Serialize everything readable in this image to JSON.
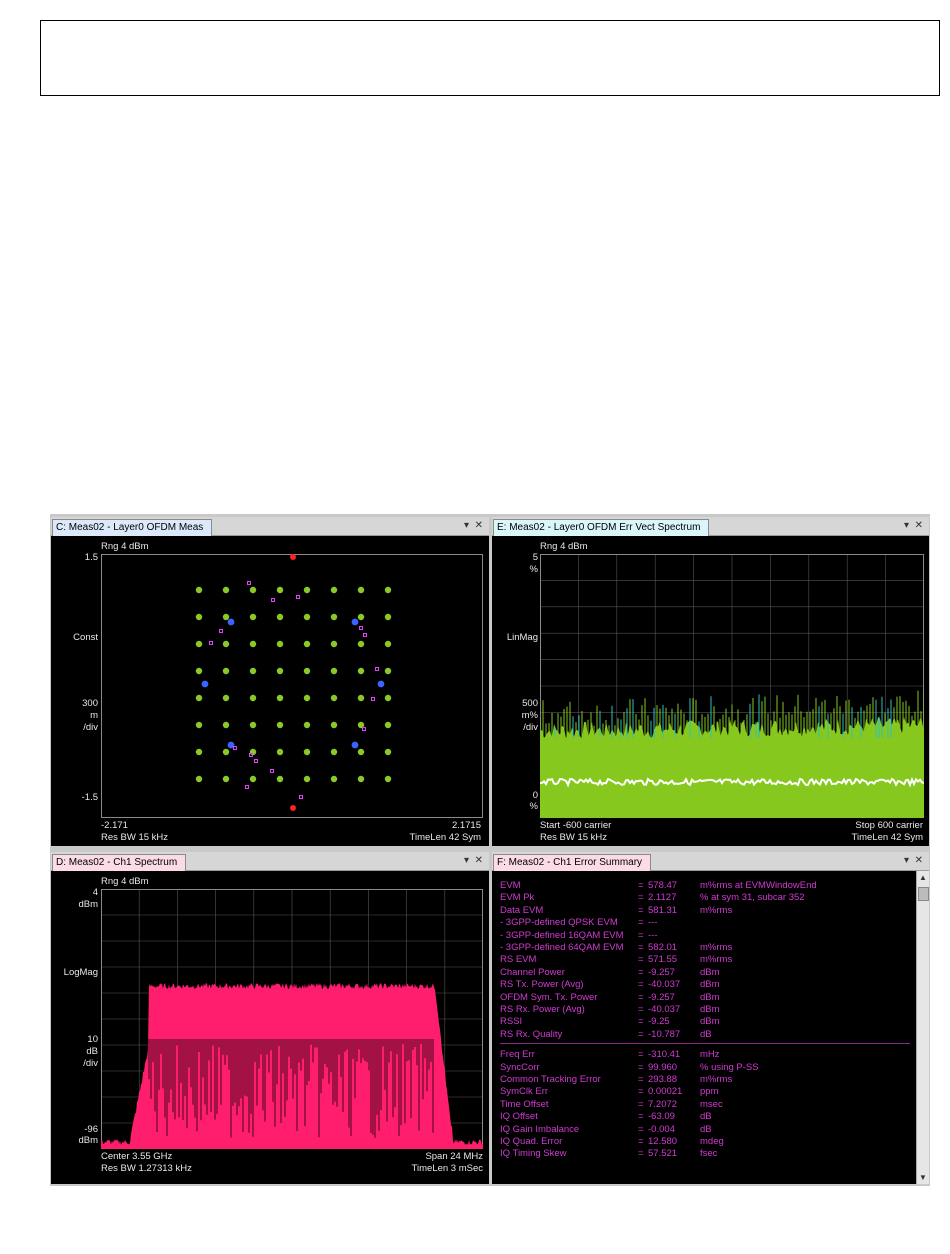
{
  "panels": {
    "c": {
      "tab": "C: Meas02 - Layer0 OFDM Meas",
      "ref": "Rng 4 dBm",
      "y_top": "1.5",
      "y_mode": "Const",
      "scale_1": "300",
      "scale_2": "m",
      "scale_3": "/div",
      "y_bottom": "-1.5",
      "x_left": "-2.171",
      "x_right": "2.1715",
      "footer_left": "Res BW 15 kHz",
      "footer_right": "TimeLen 42  Sym"
    },
    "e": {
      "tab": "E: Meas02 - Layer0 OFDM Err Vect Spectrum",
      "ref": "Rng 4 dBm",
      "y_top_1": "5",
      "y_top_2": "%",
      "y_mode": "LinMag",
      "scale_1": "500",
      "scale_2": "m%",
      "scale_3": "/div",
      "y_bottom_1": "0",
      "y_bottom_2": "%",
      "x_left": "Start -600  carrier",
      "x_right": "Stop 600  carrier",
      "footer_left": "Res BW 15 kHz",
      "footer_right": "TimeLen 42  Sym"
    },
    "d": {
      "tab": "D: Meas02 - Ch1 Spectrum",
      "ref": "Rng 4 dBm",
      "y_top_1": "4",
      "y_top_2": "dBm",
      "y_mode": "LogMag",
      "scale_1": "10",
      "scale_2": "dB",
      "scale_3": "/div",
      "y_bottom_1": "-96",
      "y_bottom_2": "dBm",
      "x_left": "Center 3.55 GHz",
      "x_right": "Span 24 MHz",
      "footer_left": "Res BW 1.27313 kHz",
      "footer_right": "TimeLen 3 mSec"
    },
    "f": {
      "tab": "F: Meas02 - Ch1 Error Summary",
      "rows": [
        {
          "name": "EVM",
          "eq": "=",
          "value": "578.47",
          "unit": "m%rms  at   EVMWindowEnd"
        },
        {
          "name": "EVM Pk",
          "eq": "=",
          "value": "2.1127",
          "unit": "%   at   sym 31,   subcar  352"
        },
        {
          "name": "Data EVM",
          "eq": "=",
          "value": "581.31",
          "unit": "m%rms"
        },
        {
          "name": " - 3GPP-defined QPSK EVM",
          "eq": "=",
          "value": "---",
          "unit": ""
        },
        {
          "name": " - 3GPP-defined 16QAM EVM",
          "eq": "=",
          "value": "---",
          "unit": ""
        },
        {
          "name": " - 3GPP-defined 64QAM EVM",
          "eq": "=",
          "value": "582.01",
          "unit": "m%rms"
        },
        {
          "name": "RS EVM",
          "eq": "=",
          "value": "571.55",
          "unit": "m%rms"
        },
        {
          "name": "Channel Power",
          "eq": "=",
          "value": "-9.257",
          "unit": "dBm"
        },
        {
          "name": "RS Tx. Power (Avg)",
          "eq": "=",
          "value": "-40.037",
          "unit": "dBm"
        },
        {
          "name": "OFDM Sym. Tx. Power",
          "eq": "=",
          "value": "-9.257",
          "unit": "dBm"
        },
        {
          "name": "RS Rx. Power (Avg)",
          "eq": "=",
          "value": "-40.037",
          "unit": "dBm"
        },
        {
          "name": "RSSI",
          "eq": "=",
          "value": "-9.25",
          "unit": "dBm"
        },
        {
          "name": "RS Rx. Quality",
          "eq": "=",
          "value": "-10.787",
          "unit": "dB"
        },
        {
          "name": "Freq Err",
          "eq": "=",
          "value": "-310.41",
          "unit": "mHz"
        },
        {
          "name": "SyncCorr",
          "eq": "=",
          "value": "99.960",
          "unit": "%   using   P-SS"
        },
        {
          "name": "Common Tracking Error",
          "eq": "=",
          "value": "293.88",
          "unit": "m%rms"
        },
        {
          "name": "SymClk Err",
          "eq": "=",
          "value": "0.00021",
          "unit": "ppm"
        },
        {
          "name": "Time Offset",
          "eq": "=",
          "value": "7.2072",
          "unit": "msec"
        },
        {
          "name": "IQ Offset",
          "eq": "=",
          "value": "-63.09",
          "unit": "dB"
        },
        {
          "name": "IQ Gain Imbalance",
          "eq": "=",
          "value": "-0.004",
          "unit": "dB"
        },
        {
          "name": "IQ Quad. Error",
          "eq": "=",
          "value": "12.580",
          "unit": "mdeg"
        },
        {
          "name": "IQ Timing Skew",
          "eq": "=",
          "value": "57.521",
          "unit": "fsec"
        }
      ]
    }
  },
  "colors": {
    "constellation_point": "#8ac926",
    "trace_green": "#86c81e",
    "trace_white": "#ffffff",
    "spectrum_trace": "#ff1e6e",
    "summary_text": "#d03bd0"
  }
}
